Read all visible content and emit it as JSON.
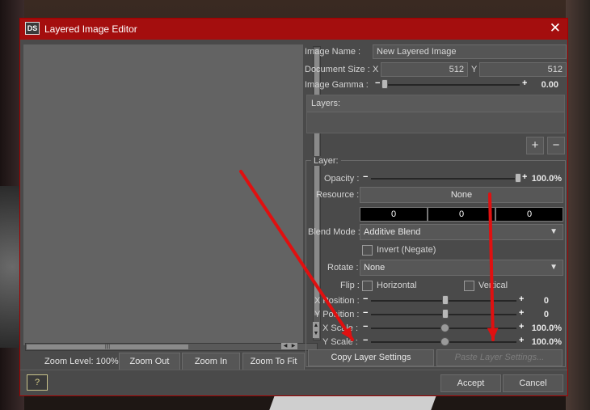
{
  "window": {
    "title": "Layered Image Editor",
    "logo": "DS",
    "close_glyph": "✕"
  },
  "left_panel": {
    "zoom_level": "Zoom Level: 100%",
    "buttons": {
      "zoom_out": "Zoom Out",
      "zoom_in": "Zoom In",
      "zoom_to_fit": "Zoom To Fit"
    }
  },
  "image": {
    "name_label": "Image Name :",
    "name_value": "New Layered Image",
    "doc_size_label": "Document Size :",
    "x_label": "X",
    "x_value": "512",
    "y_label": "Y",
    "y_value": "512",
    "gamma_label": "Image Gamma :",
    "gamma_value": "0.00"
  },
  "layers": {
    "label": "Layers:",
    "add": "+",
    "remove": "−"
  },
  "layer": {
    "group_label": "Layer:",
    "opacity_label": "Opacity :",
    "opacity_value": "100.0%",
    "resource_label": "Resource :",
    "resource_value": "None",
    "color_values": [
      "0",
      "0",
      "0"
    ],
    "blend_mode_label": "Blend Mode :",
    "blend_mode_value": "Additive Blend",
    "invert_label": "Invert (Negate)",
    "rotate_label": "Rotate :",
    "rotate_value": "None",
    "flip_label": "Flip :",
    "flip_horizontal": "Horizontal",
    "flip_vertical": "Vertical",
    "x_position_label": "X Position :",
    "x_position_value": "0",
    "y_position_label": "Y Position :",
    "y_position_value": "0",
    "x_scale_label": "X Scale :",
    "x_scale_value": "100.0%",
    "y_scale_label": "Y Scale :",
    "y_scale_value": "100.0%",
    "copy_settings": "Copy Layer Settings",
    "paste_settings": "Paste Layer Settings..."
  },
  "footer": {
    "help": "?",
    "accept": "Accept",
    "cancel": "Cancel"
  },
  "annotation_color": "#e01010"
}
